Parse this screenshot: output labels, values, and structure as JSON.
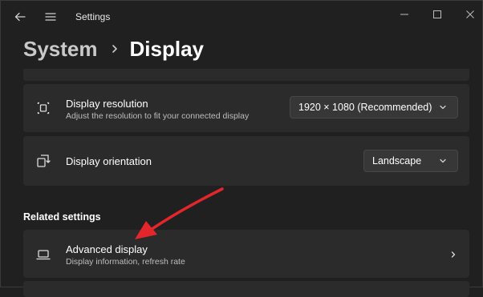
{
  "window": {
    "title": "Settings"
  },
  "breadcrumb": {
    "parent": "System",
    "current": "Display"
  },
  "settings": {
    "resolution": {
      "title": "Display resolution",
      "subtitle": "Adjust the resolution to fit your connected display",
      "value": "1920 × 1080 (Recommended)",
      "icon": "resolution-icon"
    },
    "orientation": {
      "title": "Display orientation",
      "value": "Landscape",
      "icon": "orientation-icon"
    }
  },
  "related": {
    "heading": "Related settings",
    "advanced": {
      "title": "Advanced display",
      "subtitle": "Display information, refresh rate",
      "icon": "laptop-icon"
    }
  },
  "colors": {
    "background": "#202020",
    "card": "#2b2b2b",
    "annotation_arrow": "#e3262b"
  }
}
